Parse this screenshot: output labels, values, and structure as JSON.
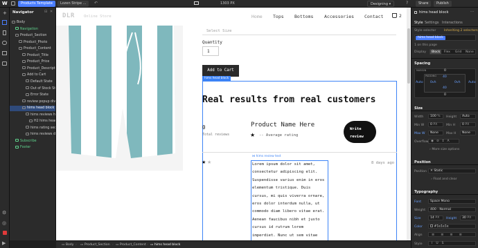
{
  "topbar": {
    "logo": "W",
    "page_label": "Products Template",
    "element_label": "Lozen Stripe ...",
    "width_readout": "1303 PX",
    "mode_label": "Designing",
    "share_label": "Share",
    "publish_label": "Publish"
  },
  "navigator": {
    "title": "Navigator",
    "items": [
      {
        "label": "Body",
        "indent": 0,
        "green": false,
        "selected": false
      },
      {
        "label": "Navigation",
        "indent": 1,
        "green": true,
        "selected": false
      },
      {
        "label": "Product_Section",
        "indent": 1,
        "green": false,
        "selected": false
      },
      {
        "label": "Product_Photo",
        "indent": 2,
        "green": false,
        "selected": false
      },
      {
        "label": "Product_Content",
        "indent": 2,
        "green": false,
        "selected": false
      },
      {
        "label": "Product_Title",
        "indent": 3,
        "green": false,
        "selected": false
      },
      {
        "label": "Product_Price",
        "indent": 3,
        "green": false,
        "selected": false
      },
      {
        "label": "Product_Descripti...",
        "indent": 3,
        "green": false,
        "selected": false
      },
      {
        "label": "Add to Cart",
        "indent": 3,
        "green": false,
        "selected": false
      },
      {
        "label": "Default State",
        "indent": 4,
        "green": false,
        "selected": false
      },
      {
        "label": "Out of Stock State",
        "indent": 4,
        "green": false,
        "selected": false
      },
      {
        "label": "Error State",
        "indent": 4,
        "green": false,
        "selected": false
      },
      {
        "label": "review popup div",
        "indent": 3,
        "green": false,
        "selected": false
      },
      {
        "label": "hims head block",
        "indent": 3,
        "green": false,
        "selected": true
      },
      {
        "label": "hims reviews hea...",
        "indent": 4,
        "green": false,
        "selected": false
      },
      {
        "label": "H2 hims header",
        "indent": 5,
        "green": false,
        "selected": false
      },
      {
        "label": "hims rating sectio...",
        "indent": 4,
        "green": false,
        "selected": false
      },
      {
        "label": "hims reviews div",
        "indent": 4,
        "green": false,
        "selected": false
      },
      {
        "label": "Subscribe",
        "indent": 1,
        "green": true,
        "selected": false
      },
      {
        "label": "Footer",
        "indent": 1,
        "green": true,
        "selected": false
      }
    ]
  },
  "site": {
    "logo": "DLR",
    "logo_sub": "Online Store",
    "nav": [
      "Home",
      "Tops",
      "Bottoms",
      "Accessories",
      "Contact"
    ],
    "cart_count": "2",
    "select_size": "Select Size",
    "quantity_label": "Quantity",
    "quantity_value": "1",
    "add_to_cart": "Add to Cart",
    "selected_tag": "hims head block",
    "review_heading": "Real results from real customers",
    "review_count": "0",
    "review_count_label": "Total reviews",
    "product_name": "Product Name Here",
    "avg_rating_label": "-- Average rating",
    "write_review_line1": "Write",
    "write_review_line2": "review",
    "review_text_tag": "hims review text",
    "review_age": "8 days ago",
    "review_body": "Lorem ipsum dolor sit amet, consectetur adipiscing elit. Suspendisse varius enim in eros elementum tristique. Duis cursus, mi quis viverra ornare, eros dolor interdum nulla, ut commodo diam libero vitae erat. Aenean faucibus nibh et justo cursus id rutrum lorem imperdiet. Nunc ut sem vitae risus tristique posuere."
  },
  "rightpanel": {
    "selected_element": "hims head block",
    "tabs": [
      "Style",
      "Settings",
      "Interactions"
    ],
    "style_selector_label": "Style selector",
    "inheriting_label": "Inheriting 2 selectors",
    "class_chip": "hims head block",
    "on_page": "1 on this page",
    "display_label": "Display",
    "display_options": [
      "Block",
      "Flex",
      "Grid",
      "None"
    ],
    "spacing_title": "Spacing",
    "margin_label": "MARGIN",
    "padding_label": "PADDING",
    "margin_top": "0",
    "margin_left": "Auto",
    "margin_right": "Auto",
    "padding_top": "40",
    "padding_left": "0vh",
    "padding_right": "0vh",
    "padding_bottom": "40",
    "margin_bottom": "0",
    "size_title": "Size",
    "width_label": "Width",
    "width_value": "100",
    "width_unit": "%",
    "height_label": "Height",
    "height_value": "Auto",
    "minw_label": "Min W",
    "minw_value": "0",
    "minw_unit": "PX",
    "minh_label": "Min H",
    "minh_value": "0",
    "minh_unit": "PX",
    "maxw_label": "Max W",
    "maxw_value": "None",
    "maxh_label": "Max H",
    "maxh_value": "None",
    "overflow_label": "Overflow",
    "more_size": "More size options",
    "position_title": "Position",
    "position_label": "Position",
    "position_value": "Static",
    "float_clear": "Float and clear",
    "typography_title": "Typography",
    "font_label": "Font",
    "font_value": "Space Mono",
    "weight_label": "Weight",
    "weight_value": "400 - Normal",
    "size_label": "Size",
    "size_value": "14",
    "size_unit": "PX",
    "lineheight_label": "Height",
    "lineheight_value": "30",
    "lineheight_unit": "PX",
    "color_label": "Color",
    "color_value": "#1e1e1e",
    "align_label": "Align",
    "style_label": "Style"
  },
  "breadcrumbs": [
    "Body",
    "Product_Section",
    "Product_Content",
    "hims head block"
  ],
  "colors": {
    "accent": "#4a7dff",
    "selection": "#3b82f6",
    "stripe_teal": "#7fb8bd",
    "green_symbol": "#5fd38d",
    "dark_button": "#1a1a1a"
  }
}
